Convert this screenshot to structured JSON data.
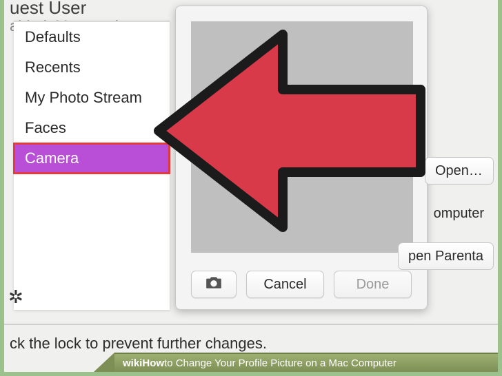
{
  "background": {
    "user_name": "uest User",
    "user_sub": "abled, Managed"
  },
  "sidebar": {
    "items": [
      {
        "label": "Defaults",
        "selected": false
      },
      {
        "label": "Recents",
        "selected": false
      },
      {
        "label": "My Photo Stream",
        "selected": false
      },
      {
        "label": "Faces",
        "selected": false
      },
      {
        "label": "Camera",
        "selected": true
      }
    ]
  },
  "popover": {
    "camera_button_icon": "camera-icon",
    "cancel_label": "Cancel",
    "done_label": "Done"
  },
  "right_buttons": {
    "open_label": "Open…",
    "computer_label": "omputer",
    "parental_label": "pen Parenta"
  },
  "footer": {
    "lock_text": "ck the lock to prevent further changes."
  },
  "caption": {
    "brand": "wiki",
    "prefix": "How",
    "text": " to Change Your Profile Picture on a Mac Computer"
  },
  "annotation": {
    "arrow_color": "#d93a4a",
    "highlight_color": "#e33b3e"
  }
}
